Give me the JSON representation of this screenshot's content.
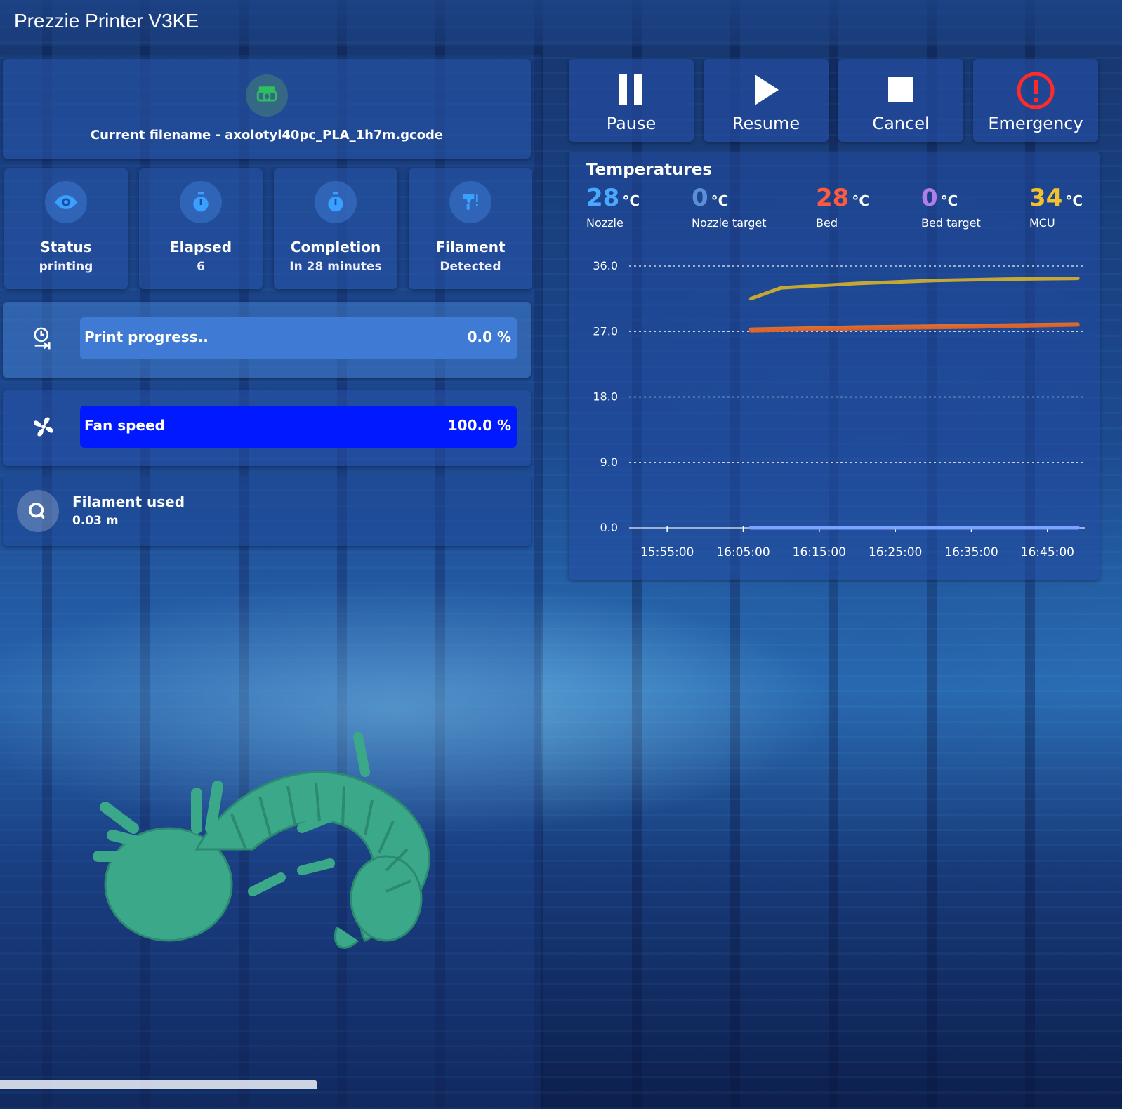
{
  "app": {
    "title": "Prezzie Printer V3KE"
  },
  "file": {
    "label": "Current filename - axolotyl40pc_PLA_1h7m.gcode"
  },
  "stats": [
    {
      "title": "Status",
      "value": "printing",
      "icon": "eye-icon"
    },
    {
      "title": "Elapsed",
      "value": "6",
      "icon": "timer-icon"
    },
    {
      "title": "Completion",
      "value": "In 28 minutes",
      "icon": "timer-icon"
    },
    {
      "title": "Filament",
      "value": "Detected",
      "icon": "filament-sensor-icon"
    }
  ],
  "print_progress": {
    "label": "Print progress..",
    "value": "0.0 %",
    "fraction": 0.0
  },
  "fan_speed": {
    "label": "Fan speed",
    "value": "100.0 %",
    "fraction": 1.0
  },
  "filament_used": {
    "title": "Filament used",
    "value": "0.03 m"
  },
  "actions": [
    {
      "label": "Pause",
      "icon": "pause-icon"
    },
    {
      "label": "Resume",
      "icon": "play-icon"
    },
    {
      "label": "Cancel",
      "icon": "stop-icon"
    },
    {
      "label": "Emergency",
      "icon": "alert-circle-icon"
    }
  ],
  "temperatures": {
    "title": "Temperatures",
    "unit": "°C",
    "readings": [
      {
        "value": "28",
        "label": "Nozzle",
        "color": "#4aa8ff"
      },
      {
        "value": "0",
        "label": "Nozzle target",
        "color": "#5b8fd6"
      },
      {
        "value": "28",
        "label": "Bed",
        "color": "#ff5a3c"
      },
      {
        "value": "0",
        "label": "Bed target",
        "color": "#b07ee6"
      },
      {
        "value": "34",
        "label": "MCU",
        "color": "#f2c12e"
      }
    ]
  },
  "chart_data": {
    "type": "line",
    "title": "",
    "xlabel": "",
    "ylabel": "",
    "ylim": [
      0,
      36
    ],
    "xlim": [
      "15:50:00",
      "16:50:00"
    ],
    "y_ticks": [
      "36.0",
      "27.0",
      "18.0",
      "9.0",
      "0.0"
    ],
    "x_ticks": [
      "15:55:00",
      "16:05:00",
      "16:15:00",
      "16:25:00",
      "16:35:00",
      "16:45:00"
    ],
    "grid": true,
    "series": [
      {
        "name": "MCU",
        "color": "#d4b12a",
        "x": [
          "16:06:00",
          "16:10:00",
          "16:20:00",
          "16:30:00",
          "16:40:00",
          "16:49:00"
        ],
        "y": [
          31.5,
          33.0,
          33.6,
          34.0,
          34.2,
          34.3
        ]
      },
      {
        "name": "Bed",
        "color": "#e8752e",
        "x": [
          "16:06:00",
          "16:20:00",
          "16:35:00",
          "16:49:00"
        ],
        "y": [
          27.3,
          27.6,
          27.8,
          28.0
        ]
      },
      {
        "name": "Nozzle",
        "color": "#e0642a",
        "x": [
          "16:06:00",
          "16:20:00",
          "16:35:00",
          "16:49:00"
        ],
        "y": [
          27.1,
          27.4,
          27.6,
          27.9
        ]
      },
      {
        "name": "Bed target",
        "color": "#9c8cf0",
        "x": [
          "16:06:00",
          "16:49:00"
        ],
        "y": [
          0,
          0
        ]
      },
      {
        "name": "Nozzle target",
        "color": "#7ba4ff",
        "x": [
          "16:06:00",
          "16:49:00"
        ],
        "y": [
          0,
          0
        ]
      }
    ]
  }
}
